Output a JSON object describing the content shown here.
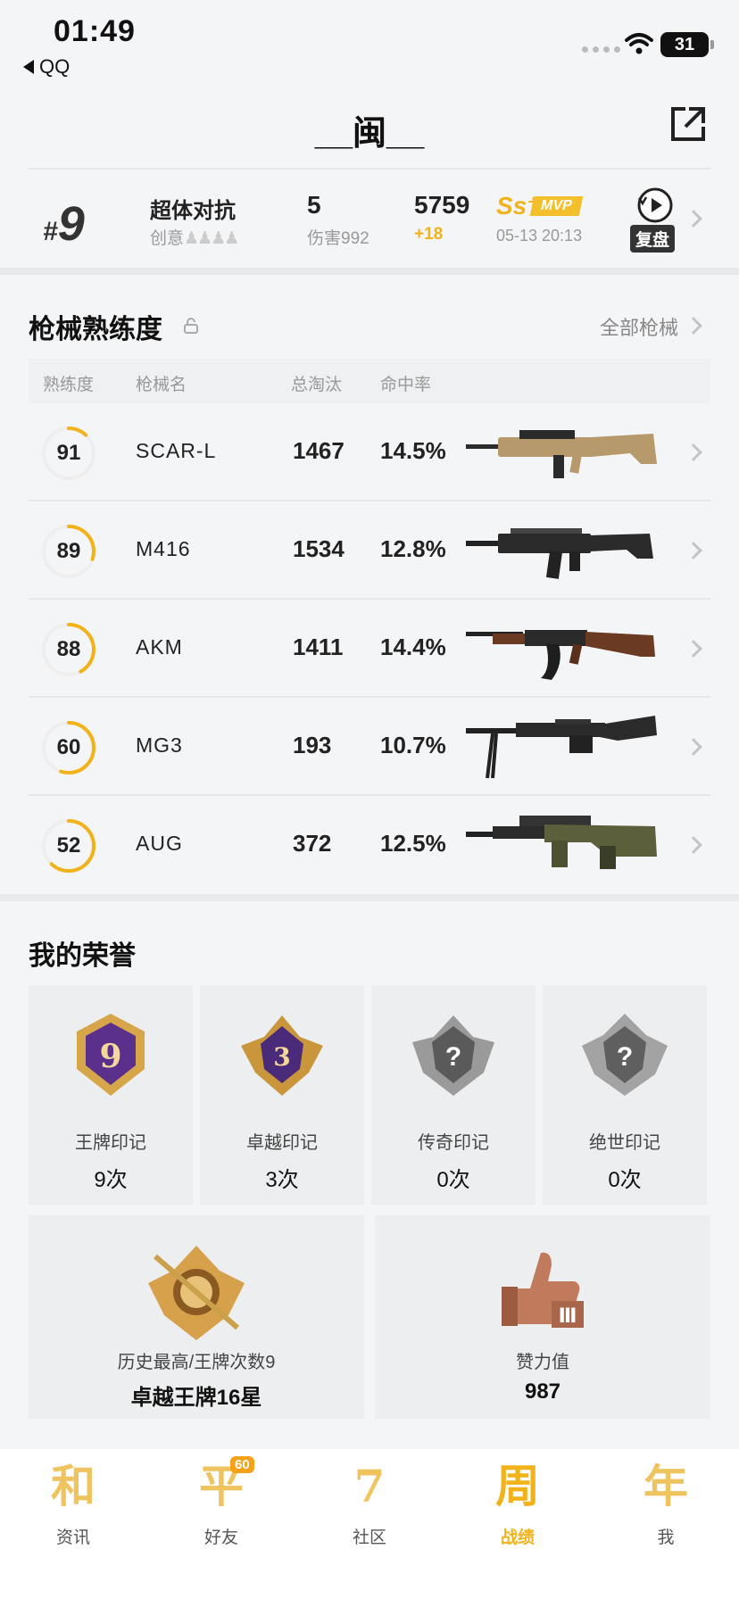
{
  "status_bar": {
    "time": "01:49",
    "back_app": "QQ",
    "battery": "31"
  },
  "header": {
    "title": "__闽__"
  },
  "recent_match": {
    "rank_prefix": "#",
    "rank": "9",
    "mode": "超体对抗",
    "mode_sub": "创意",
    "kills": "5",
    "damage": "伤害992",
    "score": "5759",
    "score_delta": "+18",
    "grade": "Ss⁺",
    "mvp": "MVP",
    "time": "05-13 20:13",
    "replay_label": "复盘"
  },
  "weapons": {
    "title": "枪械熟练度",
    "all_link": "全部枪械",
    "headers": {
      "mastery": "熟练度",
      "name": "枪械名",
      "kills": "总淘汰",
      "accuracy": "命中率"
    },
    "rows": [
      {
        "mastery": "91",
        "name": "SCAR-L",
        "kills": "1467",
        "accuracy": "14.5%",
        "progress": 0.12,
        "gun_icon": "scar-l-rifle"
      },
      {
        "mastery": "89",
        "name": "M416",
        "kills": "1534",
        "accuracy": "12.8%",
        "progress": 0.3,
        "gun_icon": "m416-rifle"
      },
      {
        "mastery": "88",
        "name": "AKM",
        "kills": "1411",
        "accuracy": "14.4%",
        "progress": 0.42,
        "gun_icon": "akm-rifle"
      },
      {
        "mastery": "60",
        "name": "MG3",
        "kills": "193",
        "accuracy": "10.7%",
        "progress": 0.55,
        "gun_icon": "mg3-machine-gun"
      },
      {
        "mastery": "52",
        "name": "AUG",
        "kills": "372",
        "accuracy": "12.5%",
        "progress": 0.62,
        "gun_icon": "aug-rifle"
      }
    ]
  },
  "honors": {
    "title": "我的荣誉",
    "cards": [
      {
        "name": "王牌印记",
        "count": "9次",
        "badge": "ace-badge",
        "badge_text": "9"
      },
      {
        "name": "卓越印记",
        "count": "3次",
        "badge": "conqueror-badge",
        "badge_text": "3"
      },
      {
        "name": "传奇印记",
        "count": "0次",
        "badge": "legend-badge-locked",
        "badge_text": "?"
      },
      {
        "name": "绝世印记",
        "count": "0次",
        "badge": "supreme-badge-locked",
        "badge_text": "?"
      }
    ],
    "peak": {
      "label": "历史最高/王牌次数9",
      "value": "卓越王牌16星"
    },
    "likes": {
      "label": "赞力值",
      "value": "987"
    }
  },
  "tabbar": {
    "tabs": [
      {
        "glyph": "和",
        "label": "资讯",
        "active": false
      },
      {
        "glyph": "平",
        "label": "好友",
        "badge": "60",
        "active": false
      },
      {
        "glyph": "7",
        "label": "社区",
        "active": false
      },
      {
        "glyph": "周",
        "label": "战绩",
        "active": true
      },
      {
        "glyph": "年",
        "label": "我",
        "active": false
      }
    ]
  },
  "colors": {
    "accent": "#f1b21a",
    "ring_track": "#eeeeee",
    "card_bg": "#eceef0"
  }
}
